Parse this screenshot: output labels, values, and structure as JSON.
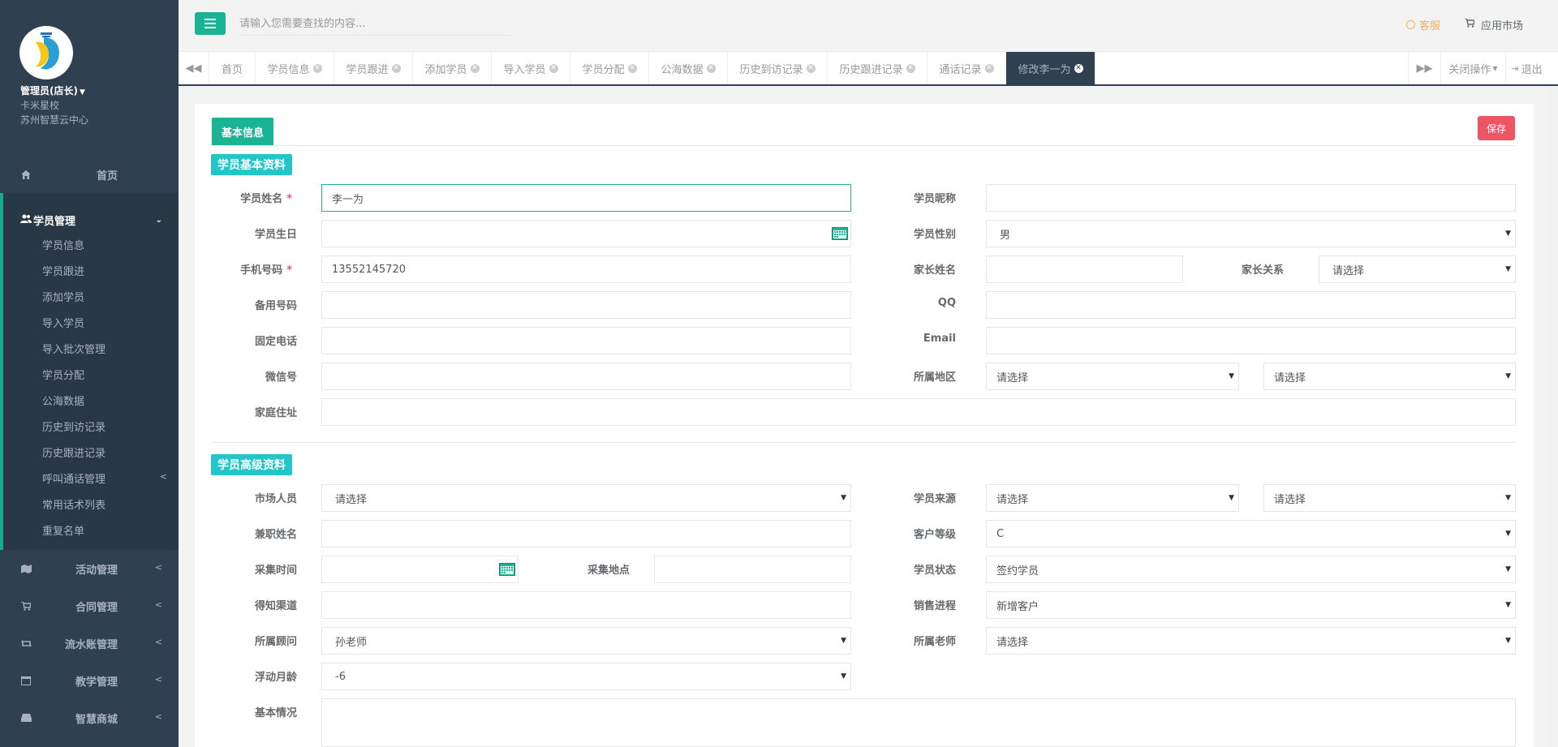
{
  "sidebar": {
    "profile": {
      "name": "管理员(店长)",
      "line1": "卡米星校",
      "line2": "苏州智慧云中心"
    },
    "home": "首页",
    "active_group": "学员管理",
    "sub_items": [
      "学员信息",
      "学员跟进",
      "添加学员",
      "导入学员",
      "导入批次管理",
      "学员分配",
      "公海数据",
      "历史到访记录",
      "历史跟进记录",
      "呼叫通话管理",
      "常用话术列表",
      "重复名单"
    ],
    "groups": [
      "活动管理",
      "合同管理",
      "流水账管理",
      "教学管理",
      "智慧商城"
    ]
  },
  "topbar": {
    "search_placeholder": "请输入您需要查找的内容...",
    "service": "客服",
    "market": "应用市场"
  },
  "tabs": [
    "首页",
    "学员信息",
    "学员跟进",
    "添加学员",
    "导入学员",
    "学员分配",
    "公海数据",
    "历史到访记录",
    "历史跟进记录",
    "通话记录",
    "修改李一为"
  ],
  "tab_actions": {
    "close_ops": "关闭操作",
    "logout": "退出"
  },
  "form": {
    "header_tab": "基本信息",
    "save": "保存",
    "section1": "学员基本资料",
    "section2": "学员高级资料",
    "placeholder_select": "请选择",
    "fields": {
      "name": {
        "label": "学员姓名",
        "value": "李一为"
      },
      "nickname": {
        "label": "学员昵称",
        "value": ""
      },
      "birthday": {
        "label": "学员生日",
        "value": ""
      },
      "gender": {
        "label": "学员性别",
        "value": "男"
      },
      "phone": {
        "label": "手机号码",
        "value": "13552145720"
      },
      "parent_name": {
        "label": "家长姓名",
        "value": ""
      },
      "parent_relation": {
        "label": "家长关系",
        "value": "请选择"
      },
      "backup_phone": {
        "label": "备用号码",
        "value": ""
      },
      "qq": {
        "label": "QQ",
        "value": ""
      },
      "landline": {
        "label": "固定电话",
        "value": ""
      },
      "email": {
        "label": "Email",
        "value": ""
      },
      "wechat": {
        "label": "微信号",
        "value": ""
      },
      "region": {
        "label": "所属地区",
        "value1": "请选择",
        "value2": "请选择"
      },
      "address": {
        "label": "家庭住址",
        "value": ""
      },
      "marketer": {
        "label": "市场人员",
        "value": "请选择"
      },
      "source": {
        "label": "学员来源",
        "value1": "请选择",
        "value2": "请选择"
      },
      "part_time": {
        "label": "兼职姓名",
        "value": ""
      },
      "level": {
        "label": "客户等级",
        "value": "C"
      },
      "collect_time": {
        "label": "采集时间",
        "value": ""
      },
      "collect_place": {
        "label": "采集地点",
        "value": ""
      },
      "status": {
        "label": "学员状态",
        "value": "签约学员"
      },
      "channel": {
        "label": "得知渠道",
        "value": ""
      },
      "sales_progress": {
        "label": "销售进程",
        "value": "新增客户"
      },
      "consultant": {
        "label": "所属顾问",
        "value": "孙老师"
      },
      "teacher": {
        "label": "所属老师",
        "value": "请选择"
      },
      "age_float": {
        "label": "浮动月龄",
        "value": "-6"
      },
      "basic_info": {
        "label": "基本情况",
        "value": ""
      }
    }
  },
  "colors": {
    "primary": "#1ab394",
    "sidebar": "#2f4050",
    "danger": "#ed5565",
    "info": "#23c6c8",
    "warning": "#f8ac59"
  }
}
